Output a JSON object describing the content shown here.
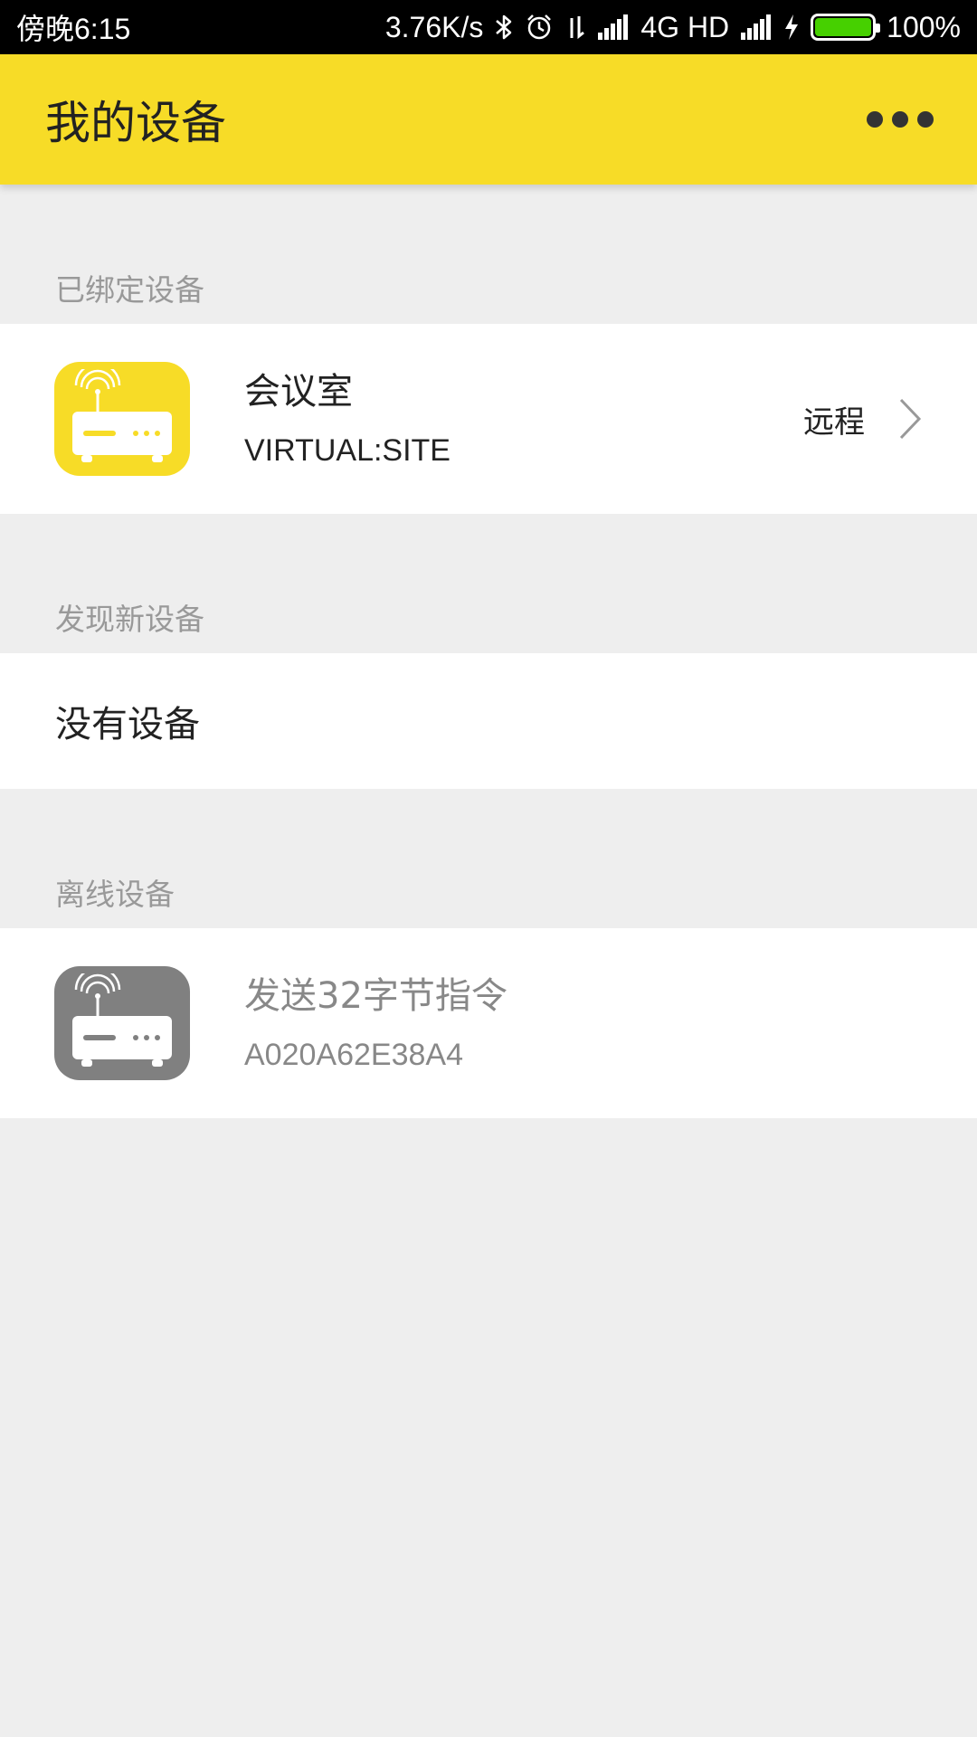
{
  "status_bar": {
    "time": "傍晚6:15",
    "network_speed": "3.76K/s",
    "network_type": "4G HD",
    "battery": "100%",
    "battery_level": 1.0,
    "icons": [
      "bluetooth-icon",
      "alarm-icon",
      "data-arrows-icon",
      "signal-icon",
      "signal-2-icon",
      "charging-icon",
      "battery-icon"
    ]
  },
  "app_bar": {
    "title": "我的设备",
    "more_icon": "more-dots-icon"
  },
  "colors": {
    "accent": "#f7dc27",
    "background": "#eeeeee",
    "offline_icon": "#808080"
  },
  "sections": {
    "bound": {
      "header": "已绑定设备",
      "device": {
        "name": "会议室",
        "id": "VIRTUAL:SITE",
        "status": "远程",
        "icon": "router-icon"
      }
    },
    "discovered": {
      "header": "发现新设备",
      "empty_text": "没有设备"
    },
    "offline": {
      "header": "离线设备",
      "device": {
        "name": "发送32字节指令",
        "id": "A020A62E38A4",
        "icon": "router-icon"
      }
    }
  }
}
